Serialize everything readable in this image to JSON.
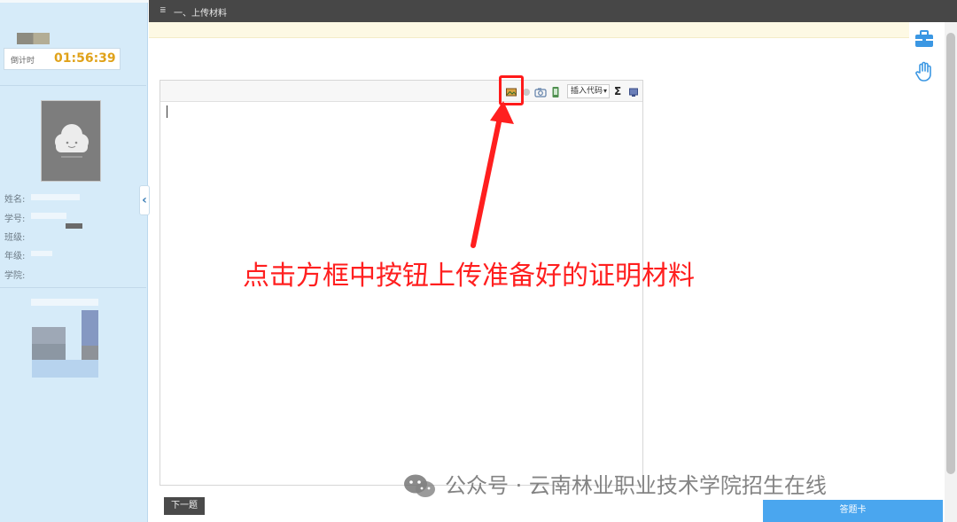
{
  "header": {
    "title": "一、上传材料"
  },
  "sidebar": {
    "timer_label": "倒计时",
    "timer_value": "01:56:39",
    "info": [
      {
        "label": "姓名:",
        "value": ""
      },
      {
        "label": "学号:",
        "value": ""
      },
      {
        "label": "班级:",
        "value": ""
      },
      {
        "label": "年级:",
        "value": ""
      },
      {
        "label": "学院:",
        "value": ""
      }
    ]
  },
  "toolbar": {
    "code_select": "插入代码",
    "sigma": "Σ",
    "icons": [
      "image-upload-icon",
      "emoji-icon",
      "camera-icon",
      "phone-icon",
      "insert-code-select",
      "sigma-icon",
      "screen-icon"
    ]
  },
  "annotation": {
    "text": "点击方框中按钮上传准备好的证明材料"
  },
  "buttons": {
    "next": "下一题",
    "answer_card": "答题卡"
  },
  "watermark": {
    "text": "公众号 · 云南林业职业技术学院招生在线"
  },
  "colors": {
    "sidebar_bg": "#d6ebf9",
    "topbar_bg": "#474747",
    "timer_color": "#e0a21a",
    "annotation_red": "#ff1f1f",
    "answer_button": "#4aa6ef"
  }
}
